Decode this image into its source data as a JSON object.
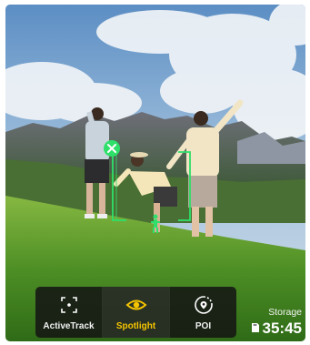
{
  "modes": [
    {
      "label": "ActiveTrack",
      "icon": "activetrack-icon",
      "selected": false
    },
    {
      "label": "Spotlight",
      "icon": "spotlight-eye-icon",
      "selected": true
    },
    {
      "label": "POI",
      "icon": "poi-icon",
      "selected": false
    }
  ],
  "storage": {
    "label": "Storage",
    "time": "35:45",
    "icon": "sd-card-icon"
  },
  "colors": {
    "accent_yellow": "#f5c400",
    "tracking_green": "#2ee06a"
  }
}
